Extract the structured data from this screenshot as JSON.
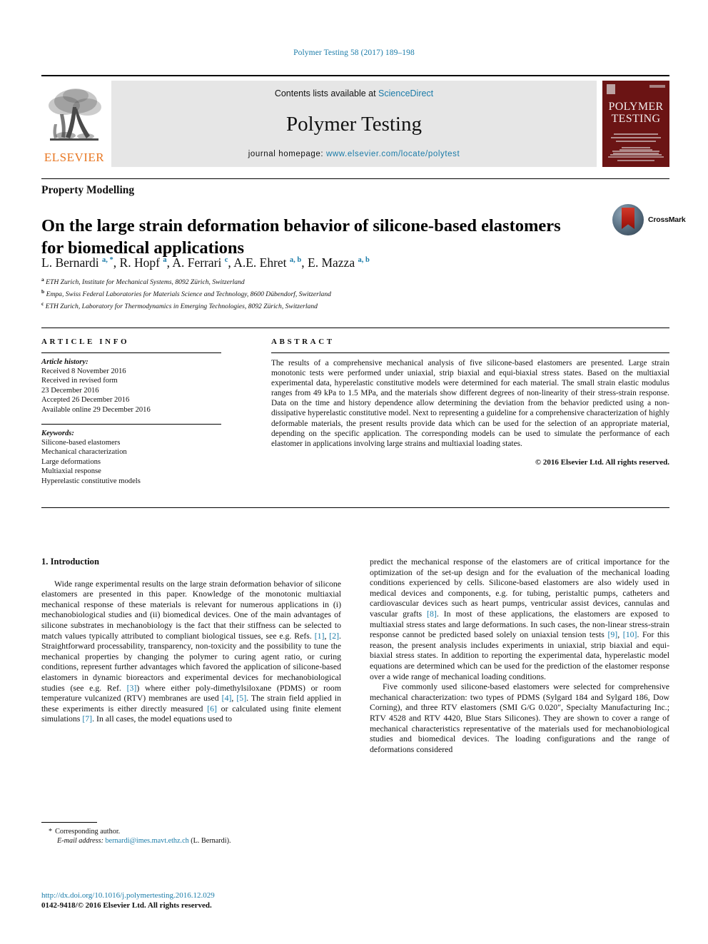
{
  "running_head": "Polymer Testing 58 (2017) 189–198",
  "masthead": {
    "contents_prefix": "Contents lists available at ",
    "sciencedirect": "ScienceDirect",
    "journal_name": "Polymer Testing",
    "homepage_prefix": "journal homepage: ",
    "homepage_url": "www.elsevier.com/locate/polytest",
    "publisher_logo_text": "ELSEVIER",
    "cover_title_line1": "POLYMER",
    "cover_title_line2": "TESTING",
    "accent_link_color": "#1a7ba8",
    "publisher_orange": "#E87722",
    "cover_maroon": "#6b1414"
  },
  "article": {
    "section_kicker": "Property Modelling",
    "title": "On the large strain deformation behavior of silicone-based elastomers for biomedical applications",
    "crossmark_label": "CrossMark",
    "authors_html": "L. Bernardi <sup>a, *</sup>, R. Hopf <sup>a</sup>, A. Ferrari <sup>c</sup>, A.E. Ehret <sup>a, b</sup>, E. Mazza <sup>a, b</sup>",
    "affiliations": [
      {
        "marker": "a",
        "text": "ETH Zurich, Institute for Mechanical Systems, 8092 Zürich, Switzerland"
      },
      {
        "marker": "b",
        "text": "Empa, Swiss Federal Laboratories for Materials Science and Technology, 8600 Dübendorf, Switzerland"
      },
      {
        "marker": "c",
        "text": "ETH Zurich, Laboratory for Thermodynamics in Emerging Technologies, 8092 Zürich, Switzerland"
      }
    ]
  },
  "article_info": {
    "heading": "ARTICLE INFO",
    "history_label": "Article history:",
    "history_lines": [
      "Received 8 November 2016",
      "Received in revised form",
      "23 December 2016",
      "Accepted 26 December 2016",
      "Available online 29 December 2016"
    ],
    "keywords_label": "Keywords:",
    "keywords": [
      "Silicone-based elastomers",
      "Mechanical characterization",
      "Large deformations",
      "Multiaxial response",
      "Hyperelastic constitutive models"
    ]
  },
  "abstract": {
    "heading": "ABSTRACT",
    "text": "The results of a comprehensive mechanical analysis of five silicone-based elastomers are presented. Large strain monotonic tests were performed under uniaxial, strip biaxial and equi-biaxial stress states. Based on the multiaxial experimental data, hyperelastic constitutive models were determined for each material. The small strain elastic modulus ranges from 49 kPa to 1.5 MPa, and the materials show different degrees of non-linearity of their stress-strain response. Data on the time and history dependence allow determining the deviation from the behavior predicted using a non-dissipative hyperelastic constitutive model. Next to representing a guideline for a comprehensive characterization of highly deformable materials, the present results provide data which can be used for the selection of an appropriate material, depending on the specific application. The corresponding models can be used to simulate the performance of each elastomer in applications involving large strains and multiaxial loading states.",
    "copyright": "© 2016 Elsevier Ltd. All rights reserved."
  },
  "body": {
    "section_number_title": "1. Introduction",
    "left_paragraph_1_a": "Wide range experimental results on the large strain deformation behavior of silicone elastomers are presented in this paper. Knowledge of the monotonic multiaxial mechanical response of these materials is relevant for numerous applications in (i) mechanobiological studies and (ii) biomedical devices. One of the main advantages of silicone substrates in mechanobiology is the fact that their stiffness can be selected to match values typically attributed to compliant biological tissues, see e.g. Refs. ",
    "ref_1": "[1]",
    "left_sep_1": ", ",
    "ref_2": "[2]",
    "left_paragraph_1_b": ". Straightforward processability, transparency, non-toxicity and the possibility to tune the mechanical properties by changing the polymer to curing agent ratio, or curing conditions, represent further advantages which favored the application of silicone-based elastomers in dynamic bioreactors and experimental devices for mechanobiological studies (see e.g. Ref. ",
    "ref_3": "[3]",
    "left_paragraph_1_c": ") where either poly-dimethylsiloxane (PDMS) or room temperature vulcanized (RTV) membranes are used ",
    "ref_4": "[4]",
    "left_sep_2": ", ",
    "ref_5": "[5]",
    "left_paragraph_1_d": ". The strain field applied in these experiments is either directly measured ",
    "ref_6": "[6]",
    "left_paragraph_1_e": " or calculated using finite element simulations ",
    "ref_7": "[7]",
    "left_paragraph_1_f": ". In all cases, the model equations used to",
    "right_paragraph_1_a": "predict the mechanical response of the elastomers are of critical importance for the optimization of the set-up design and for the evaluation of the mechanical loading conditions experienced by cells. Silicone-based elastomers are also widely used in medical devices and components, e.g. for tubing, peristaltic pumps, catheters and cardiovascular devices such as heart pumps, ventricular assist devices, cannulas and vascular grafts ",
    "ref_8": "[8]",
    "right_paragraph_1_b": ". In most of these applications, the elastomers are exposed to multiaxial stress states and large deformations. In such cases, the non-linear stress-strain response cannot be predicted based solely on uniaxial tension tests ",
    "ref_9": "[9]",
    "right_sep_1": ", ",
    "ref_10": "[10]",
    "right_paragraph_1_c": ". For this reason, the present analysis includes experiments in uniaxial, strip biaxial and equi-biaxial stress states. In addition to reporting the experimental data, hyperelastic model equations are determined which can be used for the prediction of the elastomer response over a wide range of mechanical loading conditions.",
    "right_paragraph_2": "Five commonly used silicone-based elastomers were selected for comprehensive mechanical characterization: two types of PDMS (Sylgard 184 and Sylgard 186, Dow Corning), and three RTV elastomers (SMI G/G 0.020\", Specialty Manufacturing Inc.; RTV 4528 and RTV 4420, Blue Stars Silicones). They are shown to cover a range of mechanical characteristics representative of the materials used for mechanobiological studies and biomedical devices. The loading configurations and the range of deformations considered"
  },
  "footnote": {
    "star": "*",
    "corresponding_author": "Corresponding author.",
    "email_label": "E-mail address:",
    "email": "bernardi@imes.mavt.ethz.ch",
    "email_suffix": "(L. Bernardi)."
  },
  "footer": {
    "doi": "http://dx.doi.org/10.1016/j.polymertesting.2016.12.029",
    "issn_line": "0142-9418/© 2016 Elsevier Ltd. All rights reserved."
  }
}
